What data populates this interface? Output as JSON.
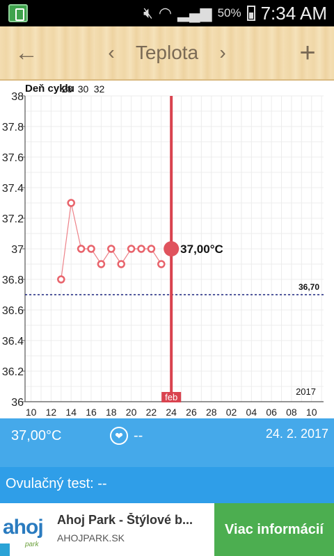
{
  "statusbar": {
    "battery": "50%",
    "time": "7:34 AM"
  },
  "header": {
    "title": "Teplota",
    "back_icon": "←",
    "prev_icon": "‹",
    "next_icon": "›",
    "add_icon": "+"
  },
  "chart_data": {
    "type": "line",
    "title": "",
    "top_label": "Deň cyklu",
    "cycle_day_ticks": [
      {
        "label": "28",
        "x": 13.6
      },
      {
        "label": "30",
        "x": 15.2
      },
      {
        "label": "32",
        "x": 16.8
      }
    ],
    "y_ticks": [
      "36",
      "36.2",
      "36.4",
      "36.6",
      "36.8",
      "37",
      "37.2",
      "37.4",
      "37.6",
      "37.8",
      "38"
    ],
    "ylim": [
      36,
      38
    ],
    "x_ticks": [
      {
        "label": "10",
        "x": 10
      },
      {
        "label": "12",
        "x": 12
      },
      {
        "label": "14",
        "x": 14
      },
      {
        "label": "16",
        "x": 16
      },
      {
        "label": "18",
        "x": 18
      },
      {
        "label": "20",
        "x": 20
      },
      {
        "label": "22",
        "x": 22
      },
      {
        "label": "24",
        "x": 24
      },
      {
        "label": "26",
        "x": 26
      },
      {
        "label": "28",
        "x": 28
      },
      {
        "label": "02",
        "x": 30
      },
      {
        "label": "04",
        "x": 32
      },
      {
        "label": "06",
        "x": 34
      },
      {
        "label": "08",
        "x": 36
      },
      {
        "label": "10",
        "x": 38
      }
    ],
    "xlim": [
      9.4,
      39.2
    ],
    "series": [
      {
        "color": "#e8636b",
        "x": [
          13,
          14,
          15,
          16,
          17,
          18,
          19,
          20,
          21,
          22,
          23
        ],
        "y": [
          36.8,
          37.3,
          37.0,
          37.0,
          36.9,
          37.0,
          36.9,
          37.0,
          37.0,
          37.0,
          36.9
        ]
      }
    ],
    "current_point": {
      "x": 24,
      "y": 37.0,
      "label": "37,00°C"
    },
    "cover_line": {
      "y": 36.7,
      "label": "36,70",
      "color": "#1a237e"
    },
    "today_marker": {
      "x": 24,
      "label": "feb",
      "color": "#d9434f"
    },
    "year_label": "2017",
    "grid": true
  },
  "info": {
    "temperature": "37,00°C",
    "heart_icon": "❤",
    "heart_value": "--",
    "date": "24. 2. 2017"
  },
  "ovulation": {
    "text": "Ovulačný test: --"
  },
  "ad": {
    "logo_text": "ahoj",
    "logo_sub": "park",
    "title": "Ahoj Park - Štýlové b...",
    "url": "AHOJPARK.SK",
    "cta": "Viac informácií"
  }
}
